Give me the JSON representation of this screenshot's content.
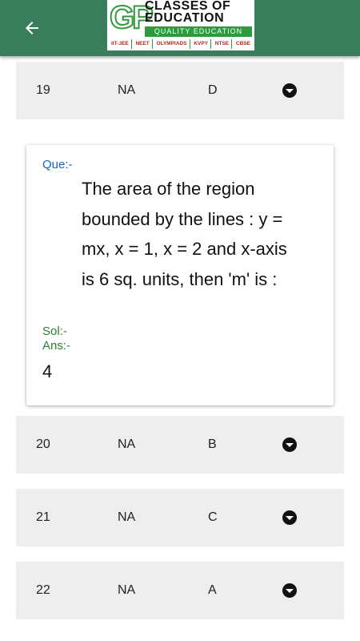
{
  "header": {
    "back_icon": "arrow-left-icon",
    "logo": {
      "initials": "GP",
      "line1": "CLASSES OF",
      "line2": "EDUCATION",
      "tagline": "QUALITY EDUCATION",
      "exams": [
        "IIT-JEE",
        "NEET",
        "OLYMPIADS",
        "KVPY",
        "NTSE",
        "CBSE"
      ]
    }
  },
  "rows": [
    {
      "number": "19",
      "status": "NA",
      "answer": "D"
    },
    {
      "number": "20",
      "status": "NA",
      "answer": "B"
    },
    {
      "number": "21",
      "status": "NA",
      "answer": "C"
    },
    {
      "number": "22",
      "status": "NA",
      "answer": "A"
    }
  ],
  "question_card": {
    "que_label": "Que:-",
    "question": "The area of the region bounded by the lines : y = mx, x = 1, x = 2 and x-axis is 6 sq. units, then 'm' is :",
    "sol_label": "Sol:-",
    "ans_label": "Ans:-",
    "answer": "4"
  },
  "colors": {
    "appbar": "#3a7d5c",
    "que_label": "#1565c0",
    "sol_ans_label": "#2e7d32",
    "row_bg": "#eeeeee"
  }
}
